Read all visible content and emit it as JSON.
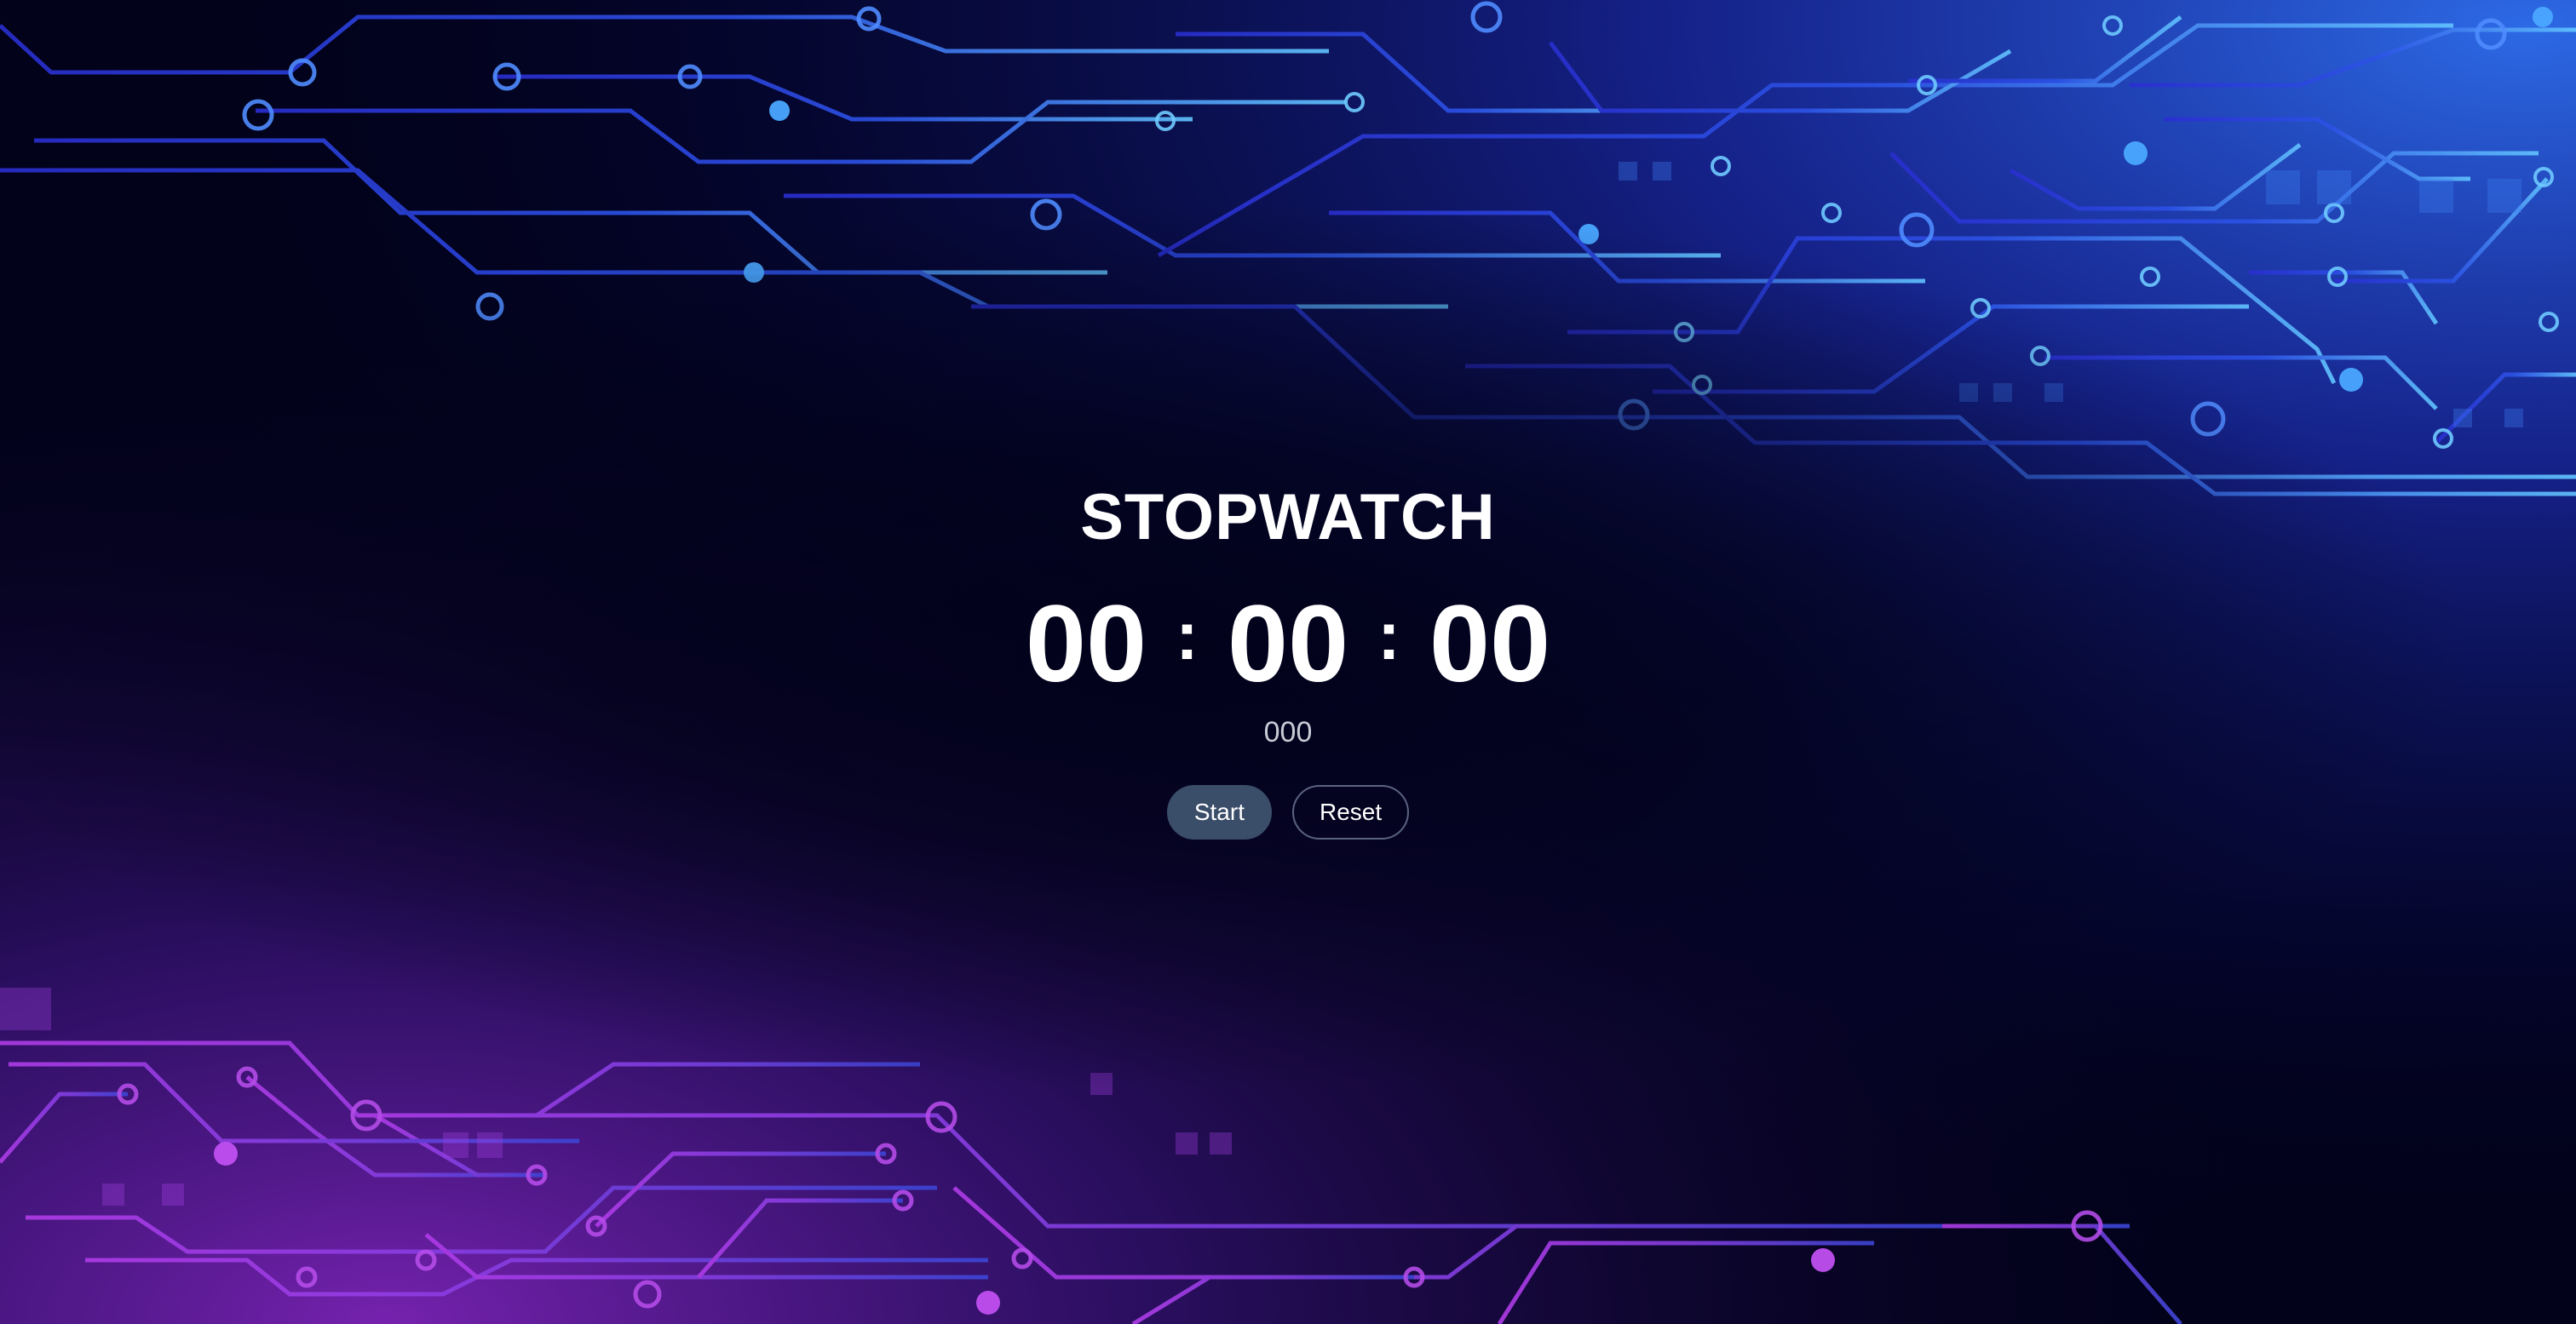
{
  "app": {
    "title": "STOPWATCH"
  },
  "timer": {
    "hours": "00",
    "minutes": "00",
    "seconds": "00",
    "separator": ":",
    "milliseconds": "000"
  },
  "controls": {
    "start_label": "Start",
    "reset_label": "Reset"
  },
  "theme": {
    "background": "#02021a",
    "circuit_top": "#2c49e0",
    "circuit_top_highlight": "#56b6ff",
    "circuit_bottom": "#a83ae6",
    "start_button_bg": "#3a4d69",
    "reset_button_border": "#5a6380",
    "text": "#ffffff",
    "milliseconds_text": "#c7cbd6"
  }
}
